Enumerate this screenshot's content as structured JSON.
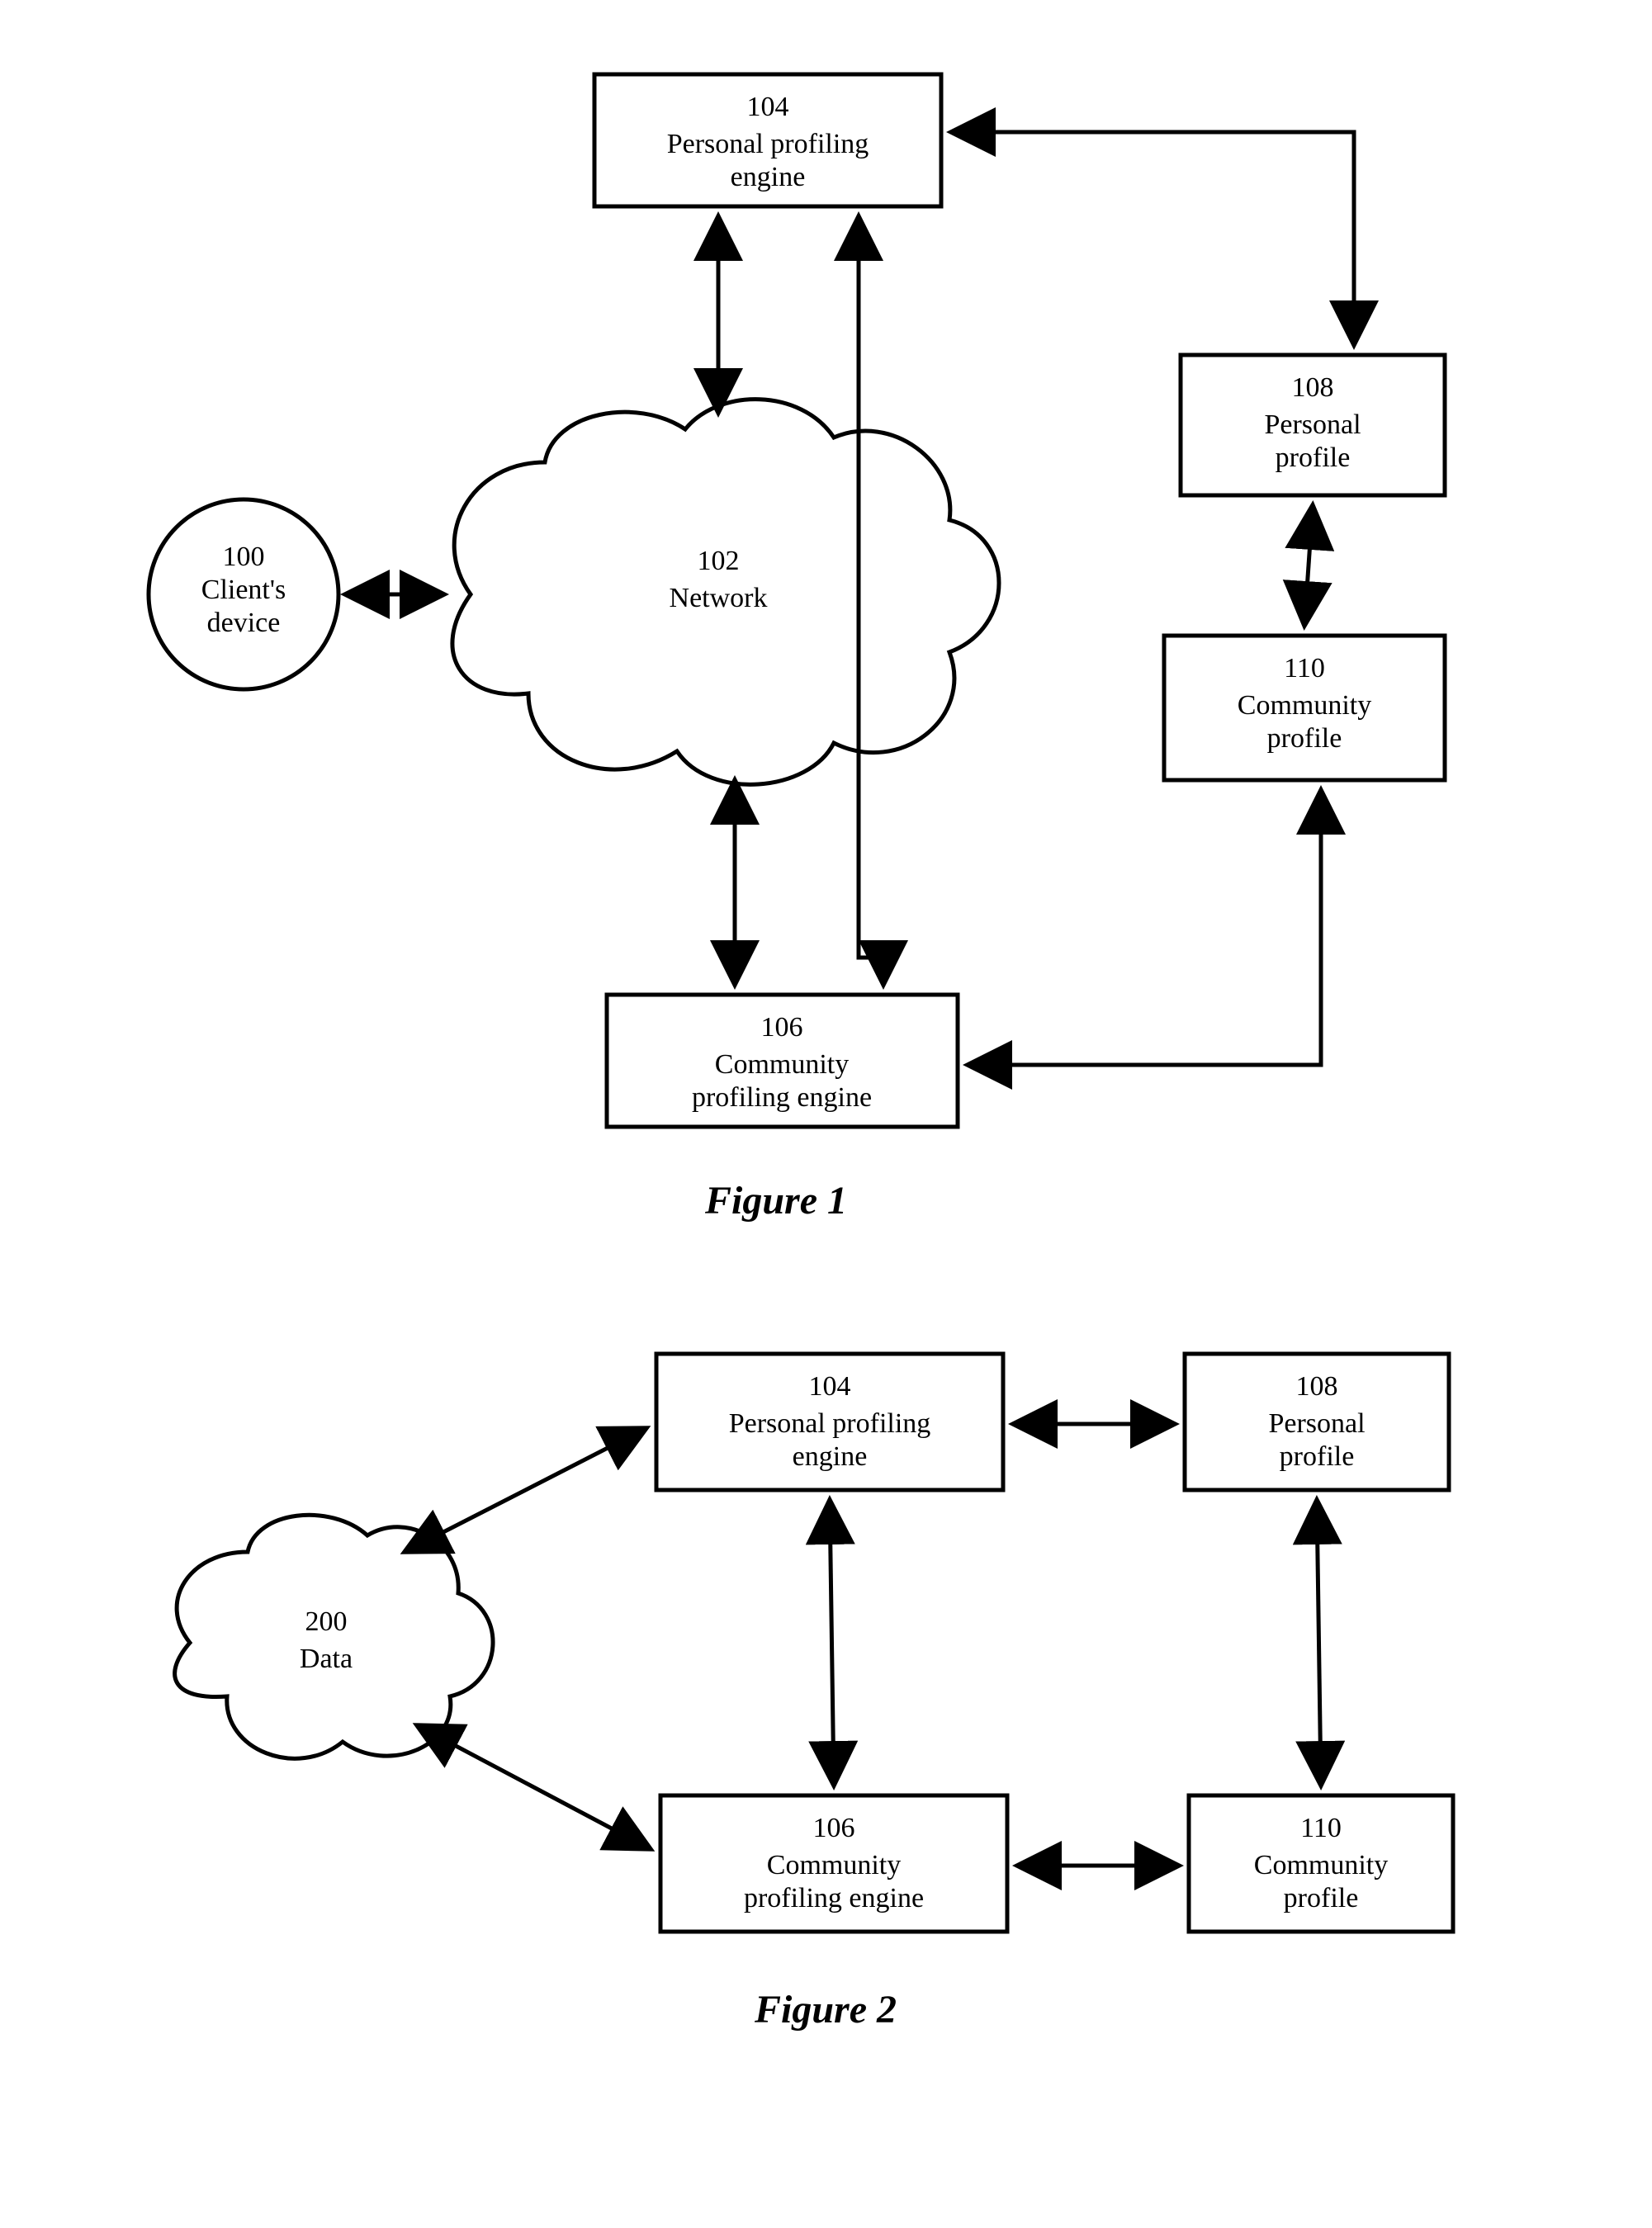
{
  "figure1": {
    "label": "Figure 1",
    "nodes": {
      "client": {
        "num": "100",
        "line1": "Client's",
        "line2": "device"
      },
      "network": {
        "num": "102",
        "line1": "Network"
      },
      "ppe": {
        "num": "104",
        "line1": "Personal profiling",
        "line2": "engine"
      },
      "cpe": {
        "num": "106",
        "line1": "Community",
        "line2": "profiling engine"
      },
      "pp": {
        "num": "108",
        "line1": "Personal",
        "line2": "profile"
      },
      "cp": {
        "num": "110",
        "line1": "Community",
        "line2": "profile"
      }
    }
  },
  "figure2": {
    "label": "Figure 2",
    "nodes": {
      "data": {
        "num": "200",
        "line1": "Data"
      },
      "ppe": {
        "num": "104",
        "line1": "Personal profiling",
        "line2": "engine"
      },
      "cpe": {
        "num": "106",
        "line1": "Community",
        "line2": "profiling engine"
      },
      "pp": {
        "num": "108",
        "line1": "Personal",
        "line2": "profile"
      },
      "cp": {
        "num": "110",
        "line1": "Community",
        "line2": "profile"
      }
    }
  }
}
